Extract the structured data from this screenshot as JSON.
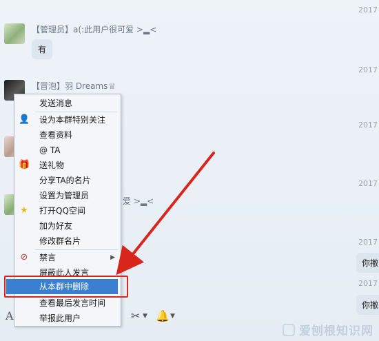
{
  "timestamps": [
    "2017",
    "2017",
    "2017",
    "2017",
    "2017",
    "2017"
  ],
  "messages": [
    {
      "nick": "【管理员】a(:此用户很可爱 >▂<",
      "text": "有"
    },
    {
      "nick": "【冒泡】羽 Dreams",
      "text": ""
    },
    {
      "nick": "",
      "text": ""
    },
    {
      "nick": "爱 >▂<",
      "text": ""
    }
  ],
  "right_bubbles": [
    "你撤",
    "你撤"
  ],
  "menu": {
    "items": [
      {
        "label": "发送消息",
        "icon": ""
      },
      {
        "label": "设为本群特别关注",
        "icon": "special-follow-icon"
      },
      {
        "label": "查看资料",
        "icon": ""
      },
      {
        "label": "@ TA",
        "icon": ""
      },
      {
        "label": "送礼物",
        "icon": "gift-icon"
      },
      {
        "label": "分享TA的名片",
        "icon": ""
      },
      {
        "label": "设置为管理员",
        "icon": ""
      },
      {
        "label": "打开QQ空间",
        "icon": "star-icon"
      },
      {
        "label": "加为好友",
        "icon": ""
      },
      {
        "label": "修改群名片",
        "icon": ""
      },
      {
        "label": "禁言",
        "icon": "mute-icon"
      },
      {
        "label": "屏蔽此人发言",
        "icon": ""
      },
      {
        "label": "从本群中删除",
        "icon": ""
      },
      {
        "label": "查看最后发言时间",
        "icon": ""
      },
      {
        "label": "举报此用户",
        "icon": ""
      }
    ],
    "highlighted": "从本群中删除"
  },
  "toolbar": {
    "font_label": "A"
  },
  "watermark": {
    "text": "爱刨根知识网"
  },
  "colors": {
    "highlight": "#3a7fd0",
    "annotation": "#d9261c"
  }
}
